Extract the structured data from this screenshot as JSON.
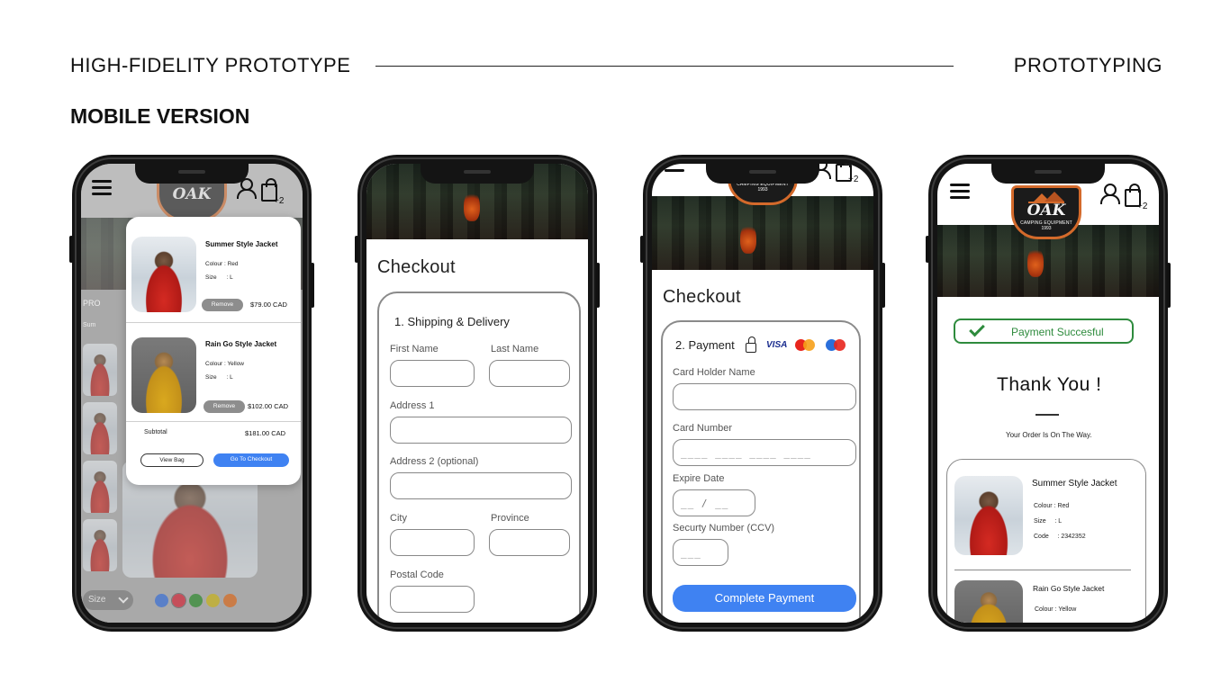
{
  "header": {
    "title": "HIGH-FIDELITY PROTOTYPE",
    "section": "PROTOTYPING",
    "subtitle": "MOBILE VERSION"
  },
  "brand": {
    "name": "OAK",
    "tagline": "CAMPING EQUIPMENT",
    "year": "1993",
    "accent": "#d46a2b"
  },
  "colors": {
    "primary_button": "#3f82f2",
    "success": "#2e8b3d",
    "remove_button": "#8d8d8d"
  },
  "icons": [
    "hamburger-menu-icon",
    "user-icon",
    "shopping-bag-icon",
    "lock-icon",
    "checkmark-icon",
    "chevron-down-icon"
  ],
  "nav": {
    "cart_count": "+2"
  },
  "phone1": {
    "cart_items": [
      {
        "name": "Summer Style Jacket",
        "colour": "Colour : Red",
        "size": "Size      : L",
        "remove_label": "Remove",
        "price": "$79.00 CAD"
      },
      {
        "name": "Rain Go Style Jacket",
        "colour": "Colour : Yellow",
        "size": "Size      : L",
        "remove_label": "Remove",
        "price": "$102.00 CAD"
      }
    ],
    "subtotal_label": "Subtotal",
    "subtotal_value": "$181.00 CAD",
    "view_bag_label": "View Bag",
    "checkout_label": "Go To Checkout",
    "bg_fragment_1": "PRO",
    "bg_fragment_2": "Sum",
    "size_select": "Size",
    "swatches": [
      "#3a6fd6",
      "#d1283a",
      "#2e8b2e",
      "#c8b21a",
      "#d86a1e"
    ]
  },
  "phone2": {
    "title": "Checkout",
    "section": "1. Shipping & Delivery",
    "labels": {
      "first_name": "First Name",
      "last_name": "Last Name",
      "address1": "Address 1",
      "address2": "Address 2 (optional)",
      "city": "City",
      "province": "Province",
      "postal": "Postal Code"
    }
  },
  "phone3": {
    "title": "Checkout",
    "section": "2. Payment",
    "card_brands": [
      "VISA",
      "MasterCard",
      "Maestro"
    ],
    "labels": {
      "holder": "Card Holder Name",
      "number": "Card Number",
      "expire": "Expire Date",
      "ccv": "Securty Number (CCV)"
    },
    "placeholders": {
      "number": "____ ____ ____ ____",
      "expire": "__ / __",
      "ccv": "___"
    },
    "cta": "Complete Payment"
  },
  "phone4": {
    "badge": "Payment Succesful",
    "thank_you": "Thank  You !",
    "message": "Your Order Is On The Way.",
    "order_items": [
      {
        "name": "Summer Style Jacket",
        "colour": "Colour : Red",
        "size": "Size     : L",
        "code": "Code     : 2342352"
      },
      {
        "name": "Rain Go Style Jacket",
        "colour": "Colour : Yellow"
      }
    ]
  }
}
